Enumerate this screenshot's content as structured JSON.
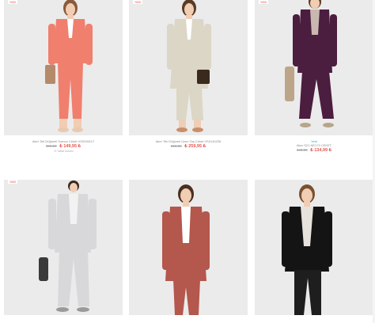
{
  "products": [
    {
      "badge": "%50",
      "name": "Aker Tek Düğmeli Somon Ceket VS2030117",
      "old_price": "499,90",
      "new_price": "₺ 149,95 ₺",
      "note": "+3 Taksit İmkanı",
      "tag": ""
    },
    {
      "badge": "%50",
      "name": "Aker Tek Düğmeli Uzun Taş Ceket VS2140226",
      "old_price": "519,90",
      "new_price": "₺ 259,95 ₺",
      "note": "",
      "tag": ""
    },
    {
      "badge": "%50",
      "name": "Aker S21 NE173 CEKET",
      "old_price": "449,90",
      "new_price": "₺ 134,99 ₺",
      "note": "",
      "tag": "Yeni"
    },
    {
      "badge": "%50",
      "name": "",
      "old_price": "",
      "new_price": "",
      "note": "",
      "tag": ""
    },
    {
      "badge": "",
      "name": "",
      "old_price": "",
      "new_price": "",
      "note": "",
      "tag": ""
    },
    {
      "badge": "",
      "name": "",
      "old_price": "",
      "new_price": "",
      "note": "",
      "tag": ""
    }
  ],
  "colors": {
    "accent_red": "#e5554f",
    "accent_blue": "#1ba1d8",
    "photo_bg": "#ebebeb",
    "suit_salmon": "#f07f6e",
    "suit_stone": "#dcd6c6",
    "suit_plum": "#4b1d3f",
    "suit_grey": "#d8d8da",
    "suit_rust": "#b4574c",
    "suit_black": "#141414"
  }
}
